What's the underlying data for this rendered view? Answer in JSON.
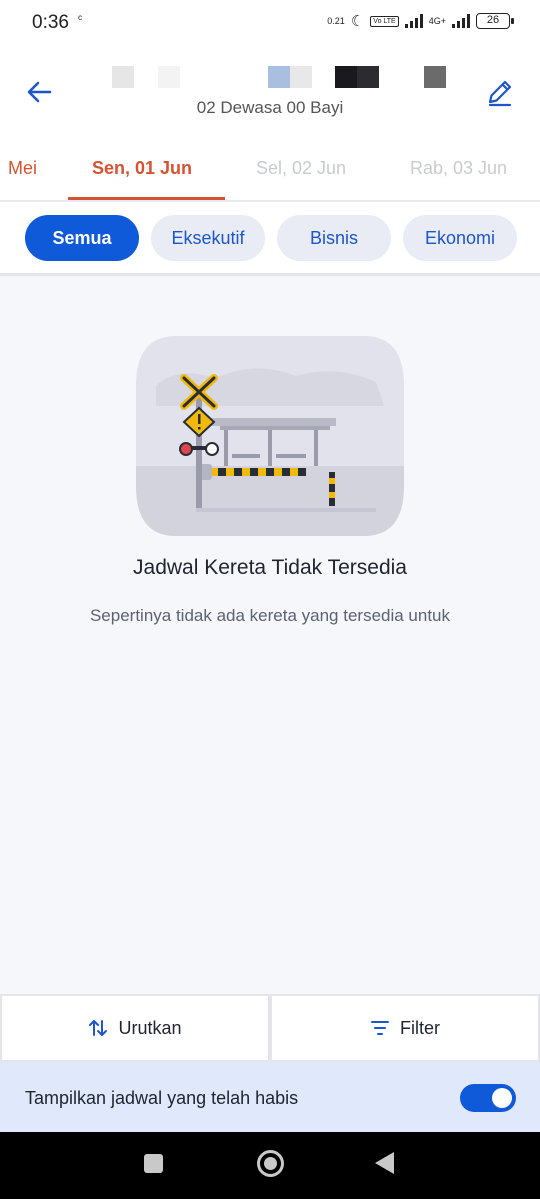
{
  "status_bar": {
    "time": "0:36",
    "time_extra": "ᶜ",
    "speed": "0.21",
    "network": "4G+",
    "volte": "Vo LTE",
    "battery": "26"
  },
  "header": {
    "passengers": "02 Dewasa 00 Bayi"
  },
  "date_tabs": {
    "prev": "Mei",
    "active": "Sen, 01 Jun",
    "next1": "Sel, 02 Jun",
    "next2": "Rab, 03 Jun"
  },
  "class_filters": [
    {
      "label": "Semua"
    },
    {
      "label": "Eksekutif"
    },
    {
      "label": "Bisnis"
    },
    {
      "label": "Ekonomi"
    }
  ],
  "empty_state": {
    "title": "Jadwal Kereta Tidak Tersedia",
    "subtitle": "Sepertinya tidak ada kereta yang tersedia untuk"
  },
  "actions": {
    "sort_label": "Urutkan",
    "filter_label": "Filter"
  },
  "toggle_row": {
    "label": "Tampilkan jadwal yang telah habis",
    "enabled": true
  },
  "colors": {
    "primary": "#0f5ad8",
    "accent": "#d65233",
    "chip_bg": "#e9ecf5"
  }
}
